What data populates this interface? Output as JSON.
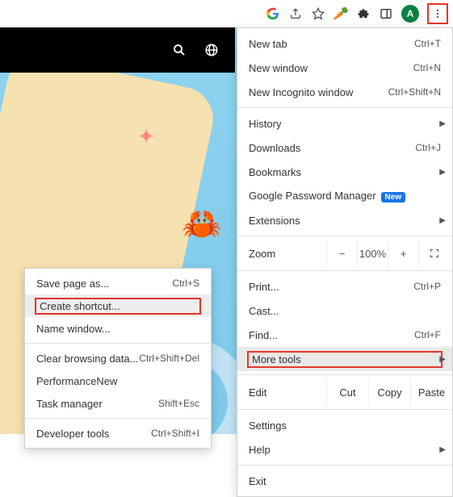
{
  "toolbar": {
    "avatar_letter": "A"
  },
  "menu": {
    "new_tab": "New tab",
    "new_tab_sc": "Ctrl+T",
    "new_window": "New window",
    "new_window_sc": "Ctrl+N",
    "incognito": "New Incognito window",
    "incognito_sc": "Ctrl+Shift+N",
    "history": "History",
    "downloads": "Downloads",
    "downloads_sc": "Ctrl+J",
    "bookmarks": "Bookmarks",
    "password_mgr": "Google Password Manager",
    "extensions": "Extensions",
    "new_badge": "New",
    "zoom_label": "Zoom",
    "zoom_minus": "−",
    "zoom_value": "100%",
    "zoom_plus": "+",
    "print": "Print...",
    "print_sc": "Ctrl+P",
    "cast": "Cast...",
    "find": "Find...",
    "find_sc": "Ctrl+F",
    "more_tools": "More tools",
    "edit_label": "Edit",
    "edit_cut": "Cut",
    "edit_copy": "Copy",
    "edit_paste": "Paste",
    "settings": "Settings",
    "help": "Help",
    "exit": "Exit"
  },
  "submenu": {
    "save_page": "Save page as...",
    "save_page_sc": "Ctrl+S",
    "create_shortcut": "Create shortcut...",
    "name_window": "Name window...",
    "clear_browsing": "Clear browsing data...",
    "clear_browsing_sc": "Ctrl+Shift+Del",
    "performance": "Performance",
    "task_manager": "Task manager",
    "task_manager_sc": "Shift+Esc",
    "developer_tools": "Developer tools",
    "developer_tools_sc": "Ctrl+Shift+I",
    "new_badge": "New"
  }
}
